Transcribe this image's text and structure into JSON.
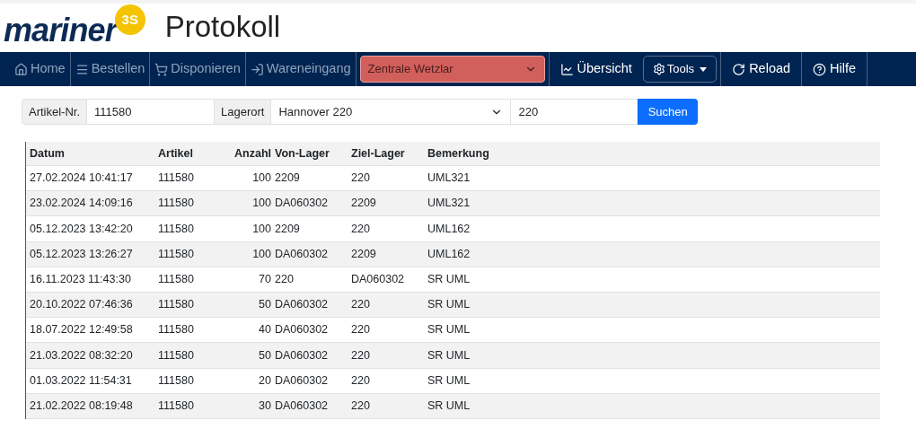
{
  "header": {
    "logo": "mariner",
    "logo_badge": "3S",
    "title": "Protokoll"
  },
  "nav": {
    "left": [
      {
        "label": "Home",
        "disabled": true
      },
      {
        "label": "Bestellen",
        "disabled": true
      },
      {
        "label": "Disponieren",
        "disabled": true
      },
      {
        "label": "Wareneingang",
        "disabled": true
      }
    ],
    "location_select": {
      "value": "Zentrale Wetzlar"
    },
    "right": [
      {
        "label": "Übersicht",
        "kind": "link"
      },
      {
        "label": "Tools",
        "kind": "dropdown"
      },
      {
        "label": "Reload",
        "kind": "link"
      },
      {
        "label": "Hilfe",
        "kind": "link"
      }
    ]
  },
  "search": {
    "article_label": "Artikel-Nr.",
    "article_value": "111580",
    "location_label": "Lagerort",
    "location_value": "Hannover 220",
    "code_value": "220",
    "button": "Suchen"
  },
  "table": {
    "columns": [
      "Datum",
      "Artikel",
      "Anzahl",
      "Von-Lager",
      "Ziel-Lager",
      "Bemerkung"
    ],
    "rows": [
      [
        "27.02.2024 10:41:17",
        "111580",
        "100",
        "2209",
        "220",
        "UML321"
      ],
      [
        "23.02.2024 14:09:16",
        "111580",
        "100",
        "DA060302",
        "2209",
        "UML321"
      ],
      [
        "05.12.2023 13:42:20",
        "111580",
        "100",
        "2209",
        "220",
        "UML162"
      ],
      [
        "05.12.2023 13:26:27",
        "111580",
        "100",
        "DA060302",
        "2209",
        "UML162"
      ],
      [
        "16.11.2023 11:43:30",
        "111580",
        "70",
        "220",
        "DA060302",
        "SR UML"
      ],
      [
        "20.10.2022 07:46:36",
        "111580",
        "50",
        "DA060302",
        "220",
        "SR UML"
      ],
      [
        "18.07.2022 12:49:58",
        "111580",
        "40",
        "DA060302",
        "220",
        "SR UML"
      ],
      [
        "21.03.2022 08:32:20",
        "111580",
        "50",
        "DA060302",
        "220",
        "SR UML"
      ],
      [
        "01.03.2022 11:54:31",
        "111580",
        "20",
        "DA060302",
        "220",
        "SR UML"
      ],
      [
        "21.02.2022 08:19:48",
        "111580",
        "30",
        "DA060302",
        "220",
        "SR UML"
      ]
    ]
  }
}
